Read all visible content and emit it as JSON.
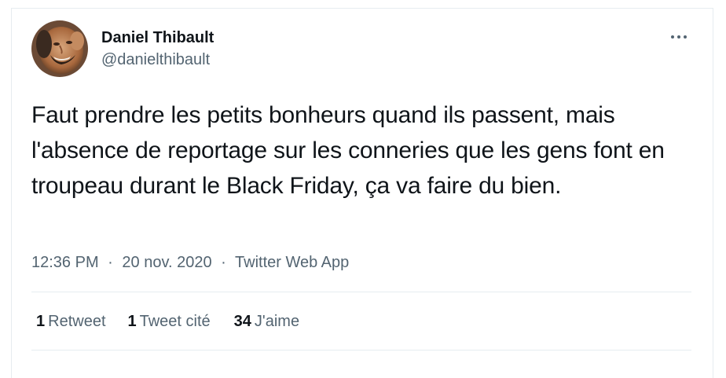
{
  "tweet": {
    "author": {
      "name": "Daniel Thibault",
      "handle": "@danielthibault"
    },
    "text": "Faut prendre les petits bonheurs quand ils passent, mais l'absence de reportage sur les conneries que les gens font en troupeau durant le Black Friday, ça va faire du bien.",
    "time": "12:36 PM",
    "date": "20 nov. 2020",
    "separator": "·",
    "source": "Twitter Web App",
    "stats": {
      "retweets": {
        "count": "1",
        "label": "Retweet"
      },
      "quotes": {
        "count": "1",
        "label": "Tweet cité"
      },
      "likes": {
        "count": "34",
        "label": "J'aime"
      }
    }
  },
  "colors": {
    "text": "#0f1419",
    "secondary": "#536471",
    "border": "#e6ecf0"
  },
  "icons": {
    "more": "more-horizontal-icon",
    "avatar": "avatar-photo"
  }
}
